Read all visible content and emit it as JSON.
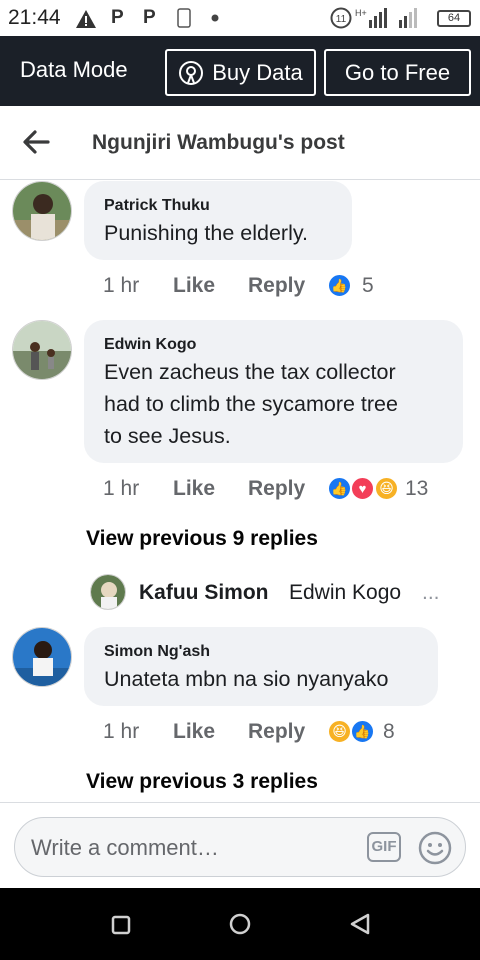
{
  "status_bar": {
    "time": "21:44",
    "battery": "64",
    "icons": [
      "warning-icon",
      "p-icon",
      "p-icon",
      "sim-icon",
      "dot-icon",
      "clock-icon",
      "data-arrows-icon",
      "signal-icon",
      "signal-icon",
      "battery-icon"
    ]
  },
  "data_bar": {
    "mode_label": "Data Mode",
    "buy_label": "Buy Data",
    "free_label": "Go to Free"
  },
  "header": {
    "title": "Ngunjiri Wambugu's post"
  },
  "comments": [
    {
      "name": "Patrick Thuku",
      "text": [
        "Punishing the elderly."
      ],
      "time": "1 hr",
      "like": "Like",
      "reply": "Reply",
      "reactions": [
        "like"
      ],
      "count": "5"
    },
    {
      "name": "Edwin Kogo",
      "text": [
        "Even zacheus the tax collector",
        "had  to climb the sycamore tree",
        "to see Jesus."
      ],
      "time": "1 hr",
      "like": "Like",
      "reply": "Reply",
      "reactions": [
        "like",
        "love",
        "haha"
      ],
      "count": "13"
    },
    {
      "name": "Simon Ng'ash",
      "text": [
        "Unateta mbn na sio nyanyako"
      ],
      "time": "1 hr",
      "like": "Like",
      "reply": "Reply",
      "reactions": [
        "haha",
        "like"
      ],
      "count": "8"
    }
  ],
  "view_more_1": "View previous 9 replies",
  "reply_preview": {
    "name": "Kafuu Simon",
    "text": "Edwin Kogo",
    "ellipsis": "..."
  },
  "view_more_2": "View previous 3 replies",
  "composer": {
    "placeholder": "Write a comment…",
    "gif_label": "GIF"
  },
  "colors": {
    "like_blue": "#1877f2",
    "love_red": "#f33e58",
    "haha_yellow": "#f7b125",
    "data_bar_bg": "#1b2028"
  }
}
